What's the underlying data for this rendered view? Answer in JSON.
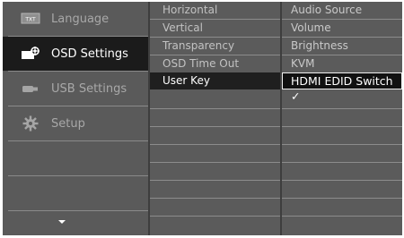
{
  "main_menu": [
    {
      "label": "Language",
      "icon": "txt-icon",
      "selected": false
    },
    {
      "label": "OSD Settings",
      "icon": "osd-settings-icon",
      "selected": true
    },
    {
      "label": "USB Settings",
      "icon": "usb-icon",
      "selected": false
    },
    {
      "label": "Setup",
      "icon": "gear-icon",
      "selected": false
    }
  ],
  "language_icon_text": "TXT",
  "submenu": [
    {
      "label": "Horizontal"
    },
    {
      "label": "Vertical"
    },
    {
      "label": "Transparency"
    },
    {
      "label": "OSD Time Out"
    },
    {
      "label": "User Key"
    }
  ],
  "options": [
    {
      "label": "Audio Source"
    },
    {
      "label": "Volume"
    },
    {
      "label": "Brightness"
    },
    {
      "label": "KVM"
    },
    {
      "label": "HDMI EDID Switch ✓"
    }
  ]
}
